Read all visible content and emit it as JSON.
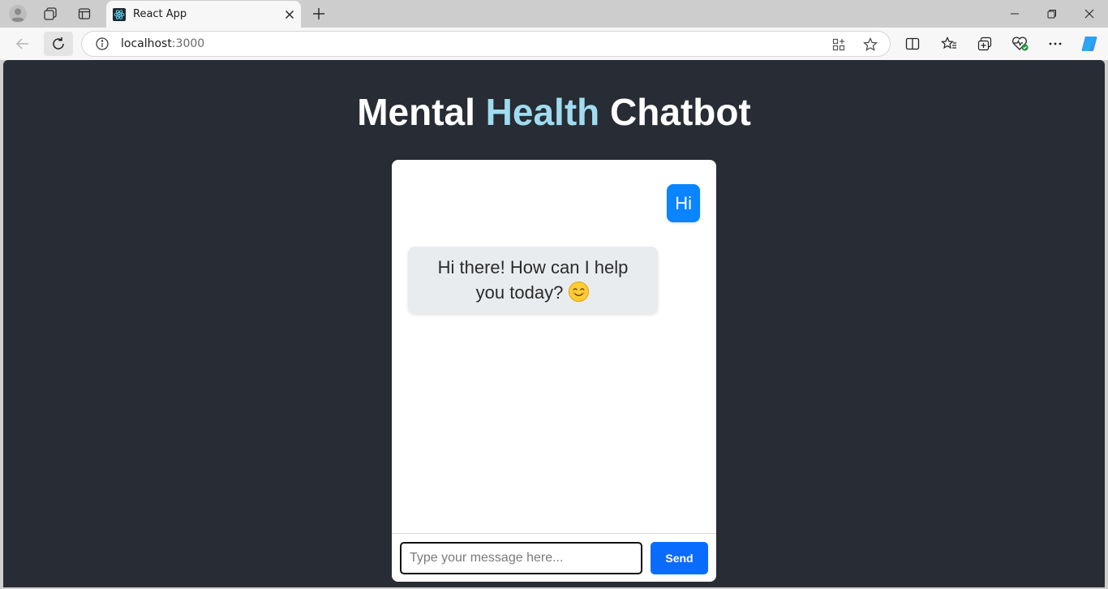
{
  "browser": {
    "tab_title": "React App",
    "url_host": "localhost",
    "url_port": ":3000"
  },
  "page": {
    "title_part1": "Mental ",
    "title_accent": "Health",
    "title_part2": " Chatbot"
  },
  "chat": {
    "messages": [
      {
        "sender": "user",
        "text": "Hi"
      },
      {
        "sender": "bot",
        "text": "Hi there! How can I help you today?",
        "emoji": "smiling-face-icon"
      }
    ],
    "input_placeholder": "Type your message here...",
    "input_value": "",
    "send_label": "Send"
  },
  "colors": {
    "page_background": "#282c34",
    "title_accent": "#9fdcf0",
    "user_bubble": "#0a84ff",
    "bot_bubble": "#e9ecef",
    "send_button": "#0a6cff"
  }
}
